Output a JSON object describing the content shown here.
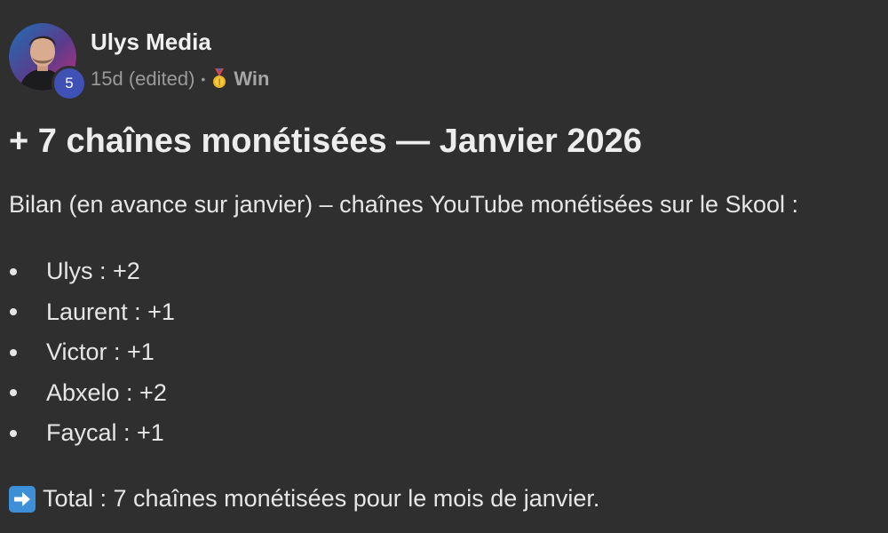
{
  "author": {
    "name": "Ulys Media",
    "level": "5"
  },
  "meta": {
    "time": "15d (edited)",
    "separator": "•",
    "category": "Win",
    "category_icon": "medal-icon"
  },
  "post": {
    "title": "+ 7 chaînes monétisées — Janvier 2026",
    "intro": "Bilan (en avance sur janvier) – chaînes YouTube monétisées sur le Skool :",
    "items": [
      "Ulys : +2",
      "Laurent : +1",
      "Victor : +1",
      "Abxelo : +2",
      "Faycal : +1"
    ],
    "total_icon": "right-arrow-icon",
    "total": "Total : 7 chaînes monétisées pour le mois de janvier."
  },
  "colors": {
    "background": "#2f2f2f",
    "text": "#e6e6e6",
    "muted": "#9a9a9a",
    "level_badge": "#3f51b5",
    "arrow_icon": "#3d8fd8"
  }
}
